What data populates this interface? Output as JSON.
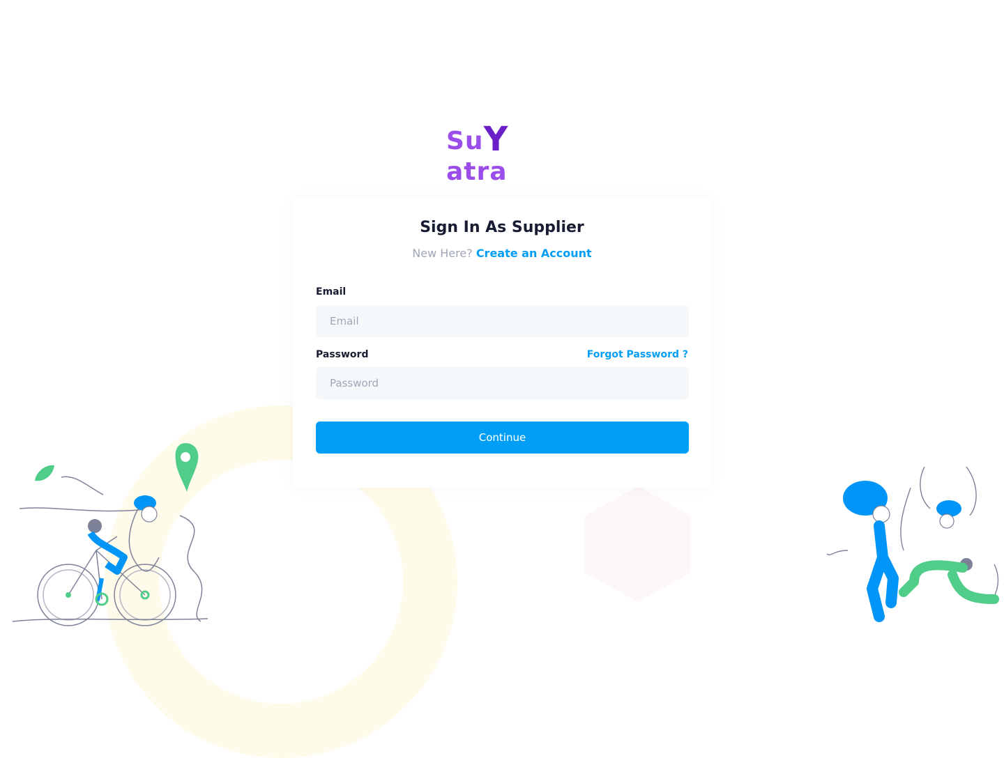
{
  "brand": {
    "logo_text_left": "Su",
    "logo_text_mark": "Y",
    "logo_text_right": "atra"
  },
  "signin": {
    "title": "Sign In As Supplier",
    "new_here": "New Here?",
    "create_account": "Create an Account",
    "email_label": "Email",
    "email_placeholder": "Email",
    "email_value": "",
    "password_label": "Password",
    "password_placeholder": "Password",
    "password_value": "",
    "forgot_password": "Forgot Password ?",
    "continue_label": "Continue"
  },
  "colors": {
    "primary": "#009ef7",
    "brand_purple": "#9b4dea",
    "title": "#181c32",
    "muted": "#a1a5b7",
    "input_bg": "#f5f8fa",
    "illustration_blue": "#0095f6",
    "illustration_green": "#50cd89"
  },
  "icons": [
    "location-pin-icon",
    "leaf-icon"
  ]
}
